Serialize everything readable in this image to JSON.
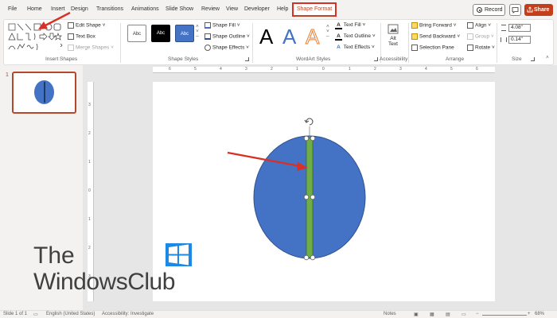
{
  "tabs": [
    {
      "label": "File"
    },
    {
      "label": "Home"
    },
    {
      "label": "Insert"
    },
    {
      "label": "Design"
    },
    {
      "label": "Transitions"
    },
    {
      "label": "Animations"
    },
    {
      "label": "Slide Show"
    },
    {
      "label": "Review"
    },
    {
      "label": "View"
    },
    {
      "label": "Developer"
    },
    {
      "label": "Help"
    }
  ],
  "active_tab": {
    "label": "Shape Format"
  },
  "header_buttons": {
    "record": "Record",
    "share": "Share"
  },
  "ribbon": {
    "insert_shapes": {
      "label": "Insert Shapes",
      "edit_shape": "Edit Shape",
      "text_box": "Text Box",
      "merge_shapes": "Merge Shapes"
    },
    "shape_styles": {
      "label": "Shape Styles",
      "thumbs": [
        "Abc",
        "Abc",
        "Abc"
      ],
      "shape_fill": "Shape Fill",
      "shape_outline": "Shape Outline",
      "shape_effects": "Shape Effects"
    },
    "wordart_styles": {
      "label": "WordArt Styles",
      "letters": [
        "A",
        "A",
        "A"
      ],
      "text_fill": "Text Fill",
      "text_outline": "Text Outline",
      "text_effects": "Text Effects"
    },
    "accessibility": {
      "label": "Accessibility",
      "alt_text_line1": "Alt",
      "alt_text_line2": "Text"
    },
    "arrange": {
      "label": "Arrange",
      "bring_forward": "Bring Forward",
      "send_backward": "Send Backward",
      "selection_pane": "Selection Pane",
      "align": "Align",
      "group": "Group",
      "rotate": "Rotate"
    },
    "size": {
      "label": "Size",
      "height": "4.08\"",
      "width": "0.14\""
    }
  },
  "thumbnails": [
    {
      "number": "1"
    }
  ],
  "ruler": {
    "top_ticks": [
      "6",
      "5",
      "4",
      "3",
      "2",
      "1",
      "0",
      "1",
      "2",
      "3",
      "4",
      "5",
      "6"
    ],
    "left_ticks": [
      "3",
      "2",
      "1",
      "0",
      "1",
      "2",
      "3"
    ]
  },
  "status_bar": {
    "slide": "Slide 1 of 1",
    "language": "English (United States)",
    "accessibility": "Accessibility: Investigate",
    "notes": "Notes",
    "zoom": "68%"
  },
  "watermark": {
    "line1": "The",
    "line2": "WindowsClub"
  },
  "colors": {
    "accent": "#b7472a",
    "circle_fill": "#4472c4",
    "bar_fill": "#70ad47",
    "annotation": "#d93025"
  }
}
